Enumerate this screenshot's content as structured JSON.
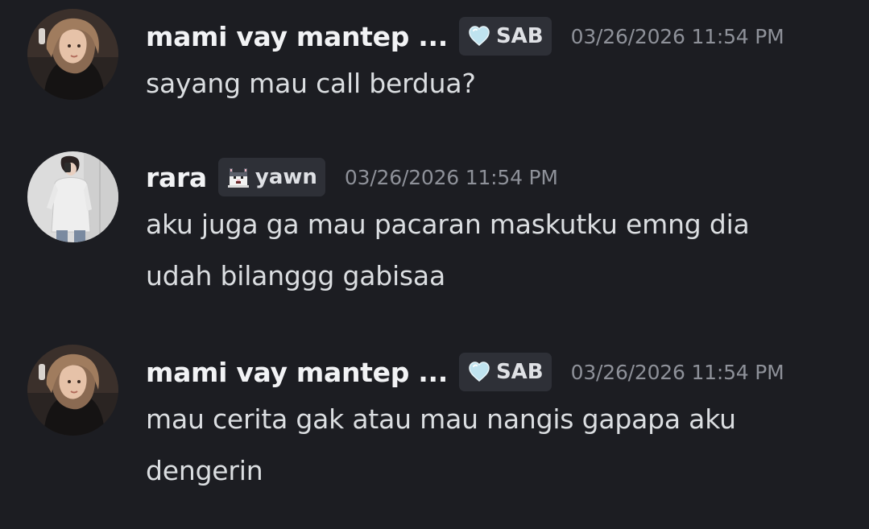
{
  "messages": [
    {
      "username": "mami vay mantep ...",
      "tag": {
        "icon": "pale-blue-heart-icon",
        "label": "SAB"
      },
      "timestamp": "03/26/2026 11:54 PM",
      "lines": [
        "sayang mau call berdua?"
      ]
    },
    {
      "username": "rara",
      "tag": {
        "icon": "pixel-cat-icon",
        "label": "yawn"
      },
      "timestamp": "03/26/2026 11:54 PM",
      "lines": [
        "aku juga ga mau pacaran maskutku emng dia",
        "udah bilanggg gabisaa"
      ]
    },
    {
      "username": "mami vay mantep ...",
      "tag": {
        "icon": "pale-blue-heart-icon",
        "label": "SAB"
      },
      "timestamp": "03/26/2026 11:54 PM",
      "lines": [
        "mau cerita gak atau mau nangis gapapa aku",
        "dengerin"
      ]
    }
  ],
  "colors": {
    "background": "#1c1d22",
    "username": "#f2f3f5",
    "message_text": "#dbdee1",
    "timestamp": "#8e9199",
    "tag_background": "#2e3037"
  }
}
